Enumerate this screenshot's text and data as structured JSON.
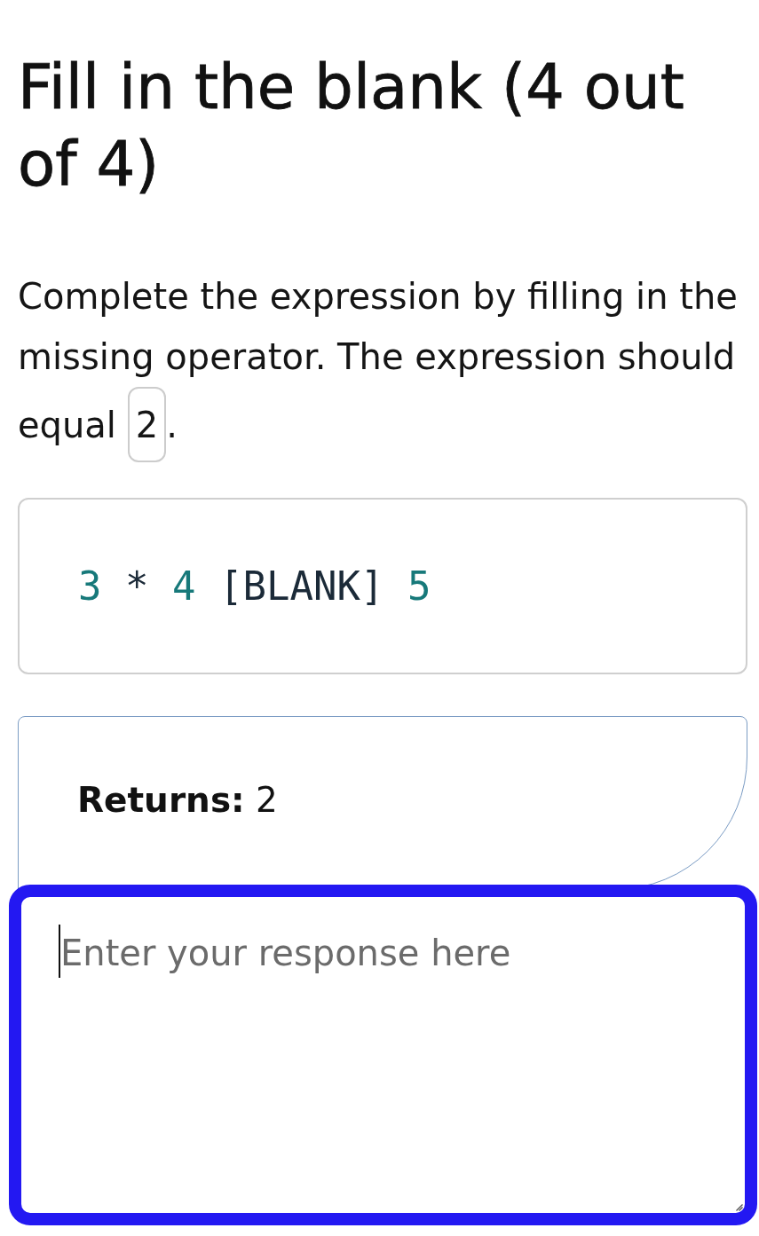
{
  "title": "Fill in the blank (4 out of 4)",
  "prompt": {
    "text": "Complete the expression by filling in the missing operator. The expression should equal",
    "value": "2",
    "end": "."
  },
  "expression": {
    "tokens": [
      {
        "text": "3",
        "kind": "number"
      },
      {
        "text": "*",
        "kind": "operator"
      },
      {
        "text": "4",
        "kind": "number"
      },
      {
        "text": "[BLANK]",
        "kind": "blank"
      },
      {
        "text": "5",
        "kind": "number"
      }
    ]
  },
  "returns": {
    "label": "Returns:",
    "value": "2"
  },
  "response": {
    "placeholder": "Enter your response here",
    "focused": true
  }
}
